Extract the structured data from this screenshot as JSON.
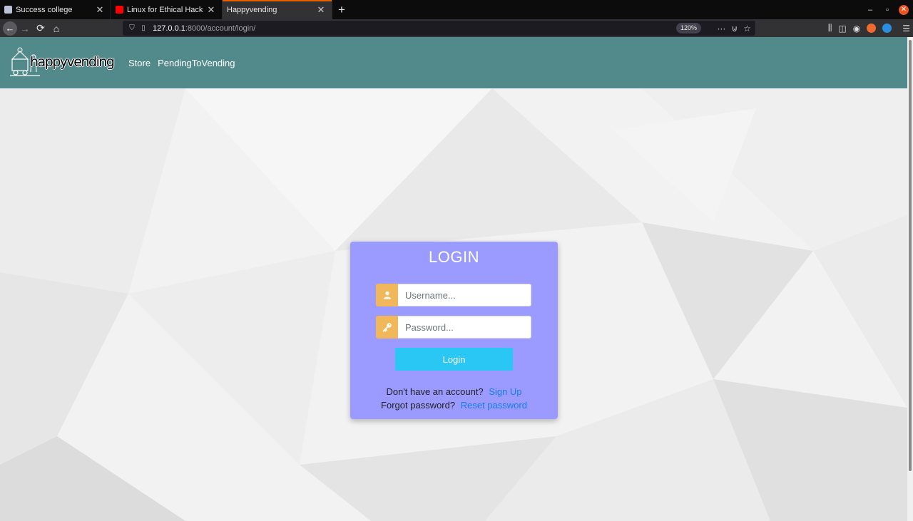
{
  "browser": {
    "tabs": [
      {
        "title": "Success college",
        "active": false
      },
      {
        "title": "Linux for Ethical Hackers",
        "active": false
      },
      {
        "title": "Happyvending",
        "active": true
      }
    ],
    "new_tab_label": "+",
    "url_host": "127.0.0.1",
    "url_rest": ":8000/account/login/",
    "zoom": "120%",
    "accent": "#e66000"
  },
  "site": {
    "logo_text": "happyvending",
    "nav": [
      {
        "label": "Store"
      },
      {
        "label": "PendingToVending"
      }
    ],
    "header_color": "#528a8c"
  },
  "login": {
    "title": "LOGIN",
    "username_placeholder": "Username...",
    "password_placeholder": "Password...",
    "button_label": "Login",
    "signup_prompt": "Don't have an account?",
    "signup_link": "Sign Up",
    "forgot_prompt": "Forgot password?",
    "reset_link": "Reset password",
    "card_color": "#9b9bff",
    "addon_color": "#f0b85a",
    "button_color": "#2ac7f5"
  },
  "icons": {
    "user": "user-icon",
    "key": "key-icon"
  }
}
